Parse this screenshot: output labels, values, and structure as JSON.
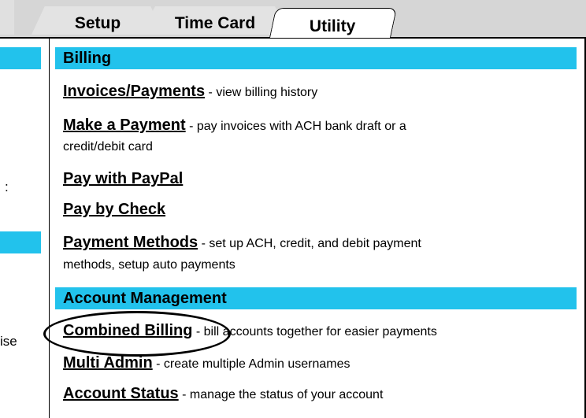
{
  "tabs": {
    "setup": "Setup",
    "time_card": "Time Card",
    "utility": "Utility"
  },
  "left_fragments": {
    "colon": ":",
    "use": "ise"
  },
  "sections": {
    "billing": {
      "header": "Billing",
      "items": [
        {
          "link": "Invoices/Payments",
          "desc": " - view billing history"
        },
        {
          "link": "Make a Payment",
          "desc": " - pay invoices with ACH bank draft or a",
          "desc2": "credit/debit card"
        },
        {
          "link": "Pay with PayPal",
          "desc": ""
        },
        {
          "link": "Pay by Check",
          "desc": ""
        },
        {
          "link": "Payment Methods",
          "desc": " - set up ACH, credit, and debit payment",
          "desc2": "methods, setup auto payments"
        }
      ]
    },
    "account_management": {
      "header": "Account Management",
      "items": [
        {
          "link": "Combined Billing",
          "desc": " - bill accounts together for easier payments"
        },
        {
          "link": "Multi Admin",
          "desc": " - create multiple Admin usernames"
        },
        {
          "link": "Account Status",
          "desc": " - manage the status of your account"
        }
      ]
    }
  },
  "colors": {
    "accent": "#22c2ec",
    "tab_bg": "#d6d6d6"
  }
}
